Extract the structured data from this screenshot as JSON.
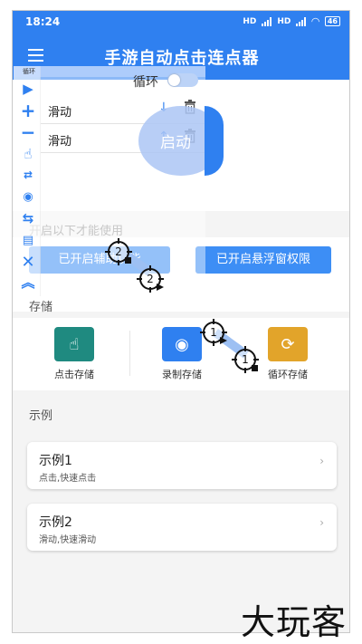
{
  "status_bar": {
    "time": "18:24",
    "signal_1": "HD",
    "signal_2": "HD",
    "battery": "46"
  },
  "app_bar": {
    "title": "手游自动点击连点器"
  },
  "overlay": {
    "chip_text": "循环",
    "loop_label": "循环",
    "rows": [
      {
        "label": "滑动"
      },
      {
        "label": "滑动"
      }
    ],
    "bubble_text": "启动"
  },
  "permission_section": {
    "hint": "开启以下才能使用",
    "btn_accessibility": "已开启辅助功能",
    "btn_overlay": "已开启悬浮窗权限"
  },
  "storage_section": {
    "title": "存储",
    "items": [
      {
        "label": "点击存储",
        "icon": "touch-icon",
        "color": "#1f8a80"
      },
      {
        "label": "录制存储",
        "icon": "record-icon",
        "color": "#2f80f0"
      },
      {
        "label": "循环存储",
        "icon": "loop-icon",
        "color": "#e2a42a"
      }
    ]
  },
  "examples_section": {
    "title": "示例",
    "cards": [
      {
        "title": "示例1",
        "subtitle": "点击,快速点击"
      },
      {
        "title": "示例2",
        "subtitle": "滑动,快速滑动"
      }
    ]
  },
  "targets": {
    "a": "2",
    "b": "2",
    "c": "1",
    "d": "1"
  },
  "watermark": "大玩客"
}
